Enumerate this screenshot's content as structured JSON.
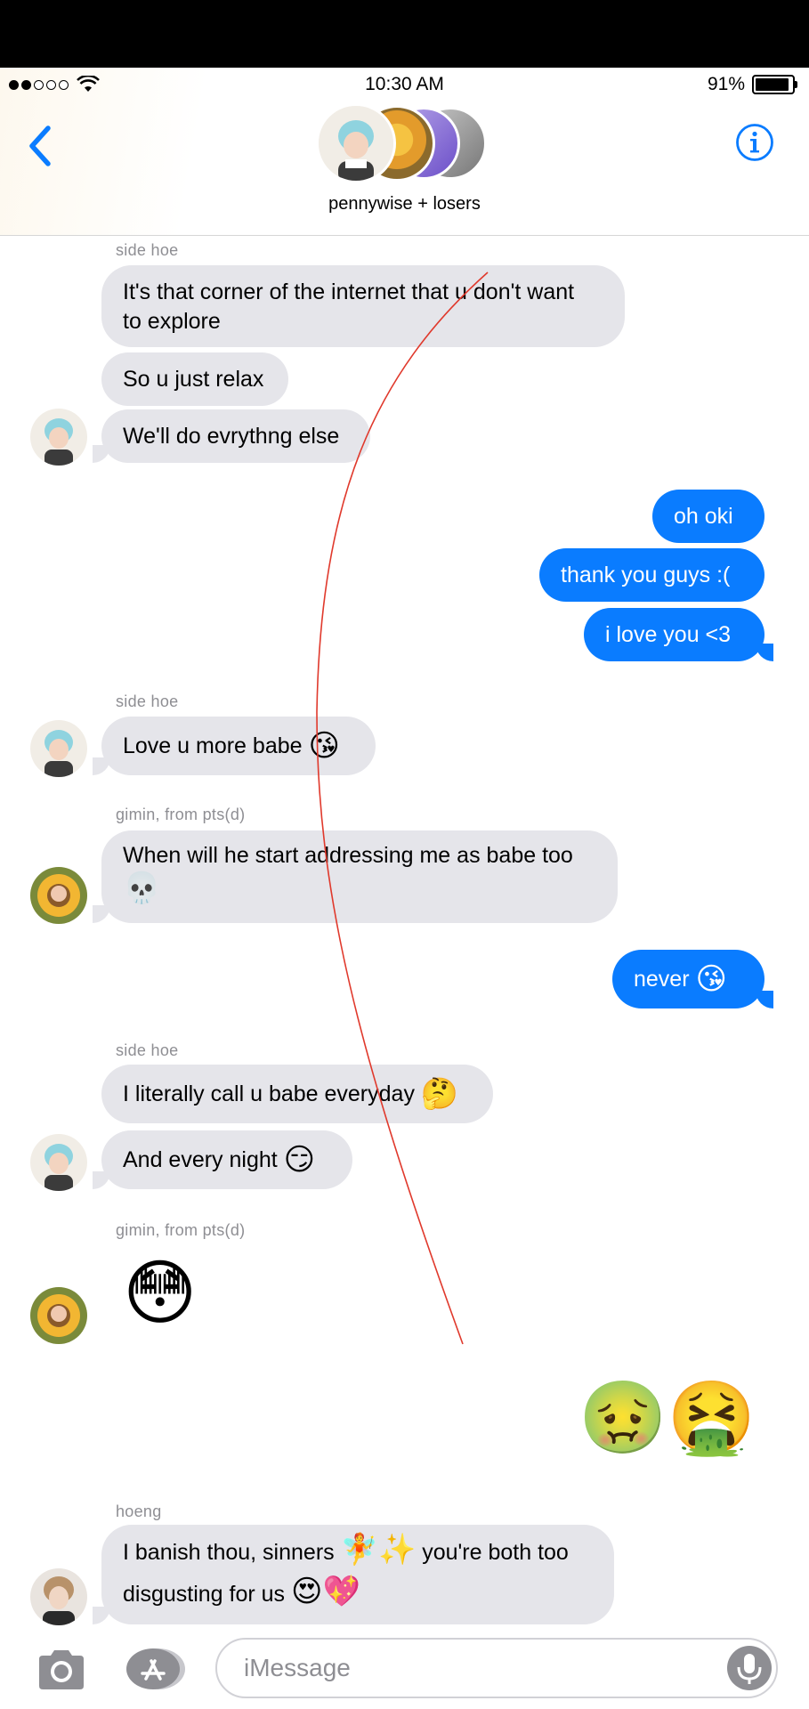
{
  "status_bar": {
    "time": "10:30 AM",
    "battery": "91%"
  },
  "header": {
    "group_name": "pennywise + losers"
  },
  "messages": [
    {
      "sender": "side hoe"
    },
    {
      "text": "It's that corner of the internet that u don't want\nto explore"
    },
    {
      "text": "So u just relax"
    },
    {
      "text": "We'll do evrythng else"
    },
    {
      "text": "oh oki"
    },
    {
      "text": "thank you guys :("
    },
    {
      "text": "i love you <3"
    },
    {
      "sender": "side hoe"
    },
    {
      "text": "Love u more babe",
      "emoji": "😘"
    },
    {
      "sender": "gimin, from pts(d)"
    },
    {
      "text": "When will he start addressing me as babe too",
      "emoji": "💀"
    },
    {
      "text": "never",
      "emoji": "😘"
    },
    {
      "sender": "side hoe"
    },
    {
      "text": "I literally call u babe everyday",
      "emoji": "🤔"
    },
    {
      "text": "And every night",
      "emoji": "😏"
    },
    {
      "sender": "gimin, from pts(d)"
    },
    {
      "emoji": "😳"
    },
    {
      "emoji": "🤢🤮"
    },
    {
      "sender": "hoeng"
    },
    {
      "text": "I banish thou, sinners",
      "emoji": "🧚✨",
      "text2": " you're both too",
      "text3": "disgusting for us ",
      "emoji2": "😍💖"
    }
  ],
  "input": {
    "placeholder": "iMessage"
  },
  "icons": [
    "back-chevron-icon",
    "info-icon",
    "camera-icon",
    "app-store-icon",
    "microphone-icon"
  ],
  "colors": {
    "accent": "#0a7cff",
    "incoming": "#e5e5ea",
    "outgoing": "#0a7cff"
  }
}
